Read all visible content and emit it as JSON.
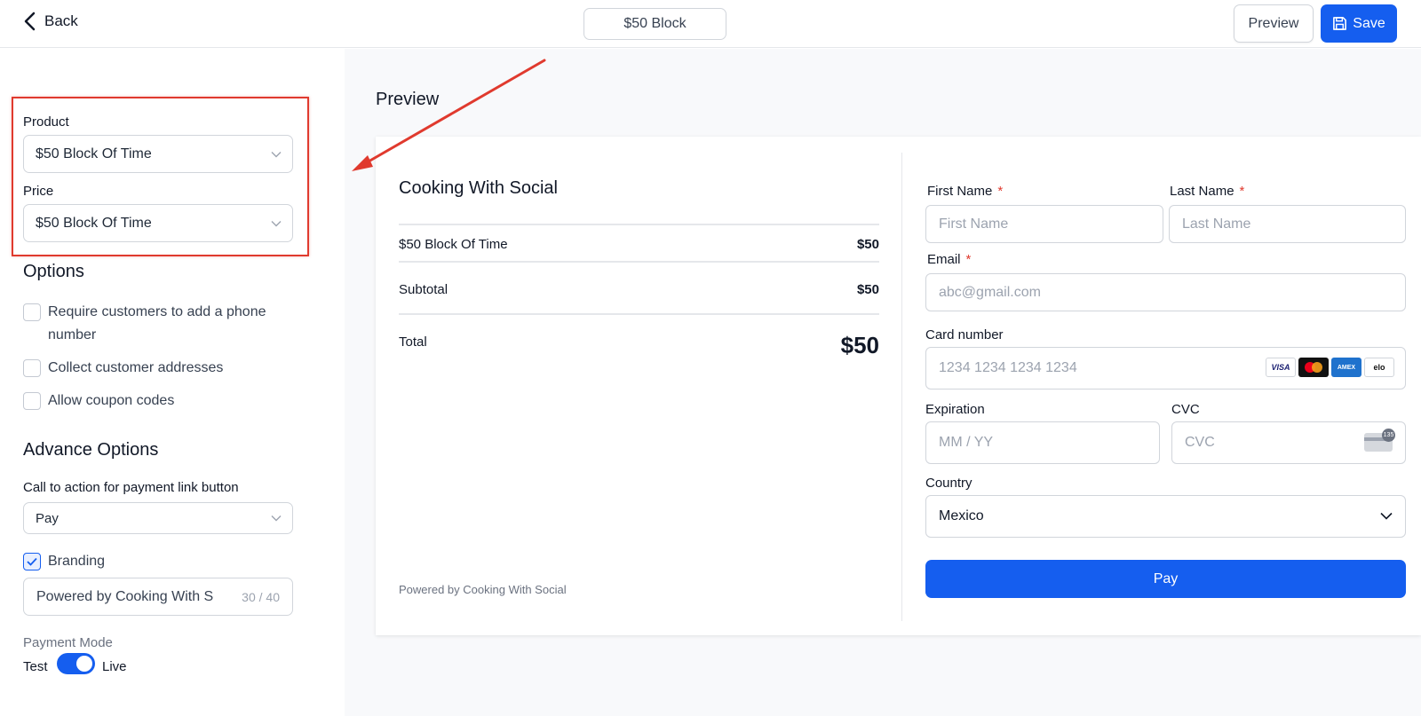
{
  "header": {
    "back_label": "Back",
    "title": "$50 Block",
    "preview_label": "Preview",
    "save_label": "Save"
  },
  "left": {
    "product_label": "Product",
    "product_value": "$50 Block Of Time",
    "price_label": "Price",
    "price_value": "$50 Block Of Time",
    "options_title": "Options",
    "options": [
      {
        "label": "Require customers to add a phone",
        "label2": "number",
        "checked": false
      },
      {
        "label": "Collect customer addresses",
        "checked": false
      },
      {
        "label": "Allow coupon codes",
        "checked": false
      }
    ],
    "advance_title": "Advance Options",
    "cta_label": "Call to action for payment link button",
    "cta_value": "Pay",
    "branding_label": "Branding",
    "branding_checked": true,
    "branding_text": "Powered by Cooking With Social",
    "branding_count": "30 / 40",
    "payment_mode_label": "Payment Mode",
    "mode_test": "Test",
    "mode_live": "Live",
    "mode_is_live": true
  },
  "preview": {
    "title": "Preview",
    "shop_name": "Cooking With Social",
    "item_name": "$50 Block Of Time",
    "item_price": "$50",
    "subtotal_label": "Subtotal",
    "subtotal_value": "$50",
    "total_label": "Total",
    "total_value": "$50",
    "powered_by": "Powered by Cooking With Social"
  },
  "form": {
    "first_name_label": "First Name",
    "first_name_placeholder": "First Name",
    "last_name_label": "Last Name",
    "last_name_placeholder": "Last Name",
    "email_label": "Email",
    "email_placeholder": "abc@gmail.com",
    "required_mark": "*",
    "card_label": "Card number",
    "card_placeholder": "1234 1234 1234 1234",
    "card_brands": [
      "VISA",
      "",
      "AMEX",
      "elo"
    ],
    "expiration_label": "Expiration",
    "expiration_placeholder": "MM / YY",
    "cvc_label": "CVC",
    "cvc_placeholder": "CVC",
    "cvc_badge": "135",
    "country_label": "Country",
    "country_value": "Mexico",
    "pay_label": "Pay"
  },
  "colors": {
    "accent": "#155eef",
    "annotation": "#e03a2e"
  }
}
